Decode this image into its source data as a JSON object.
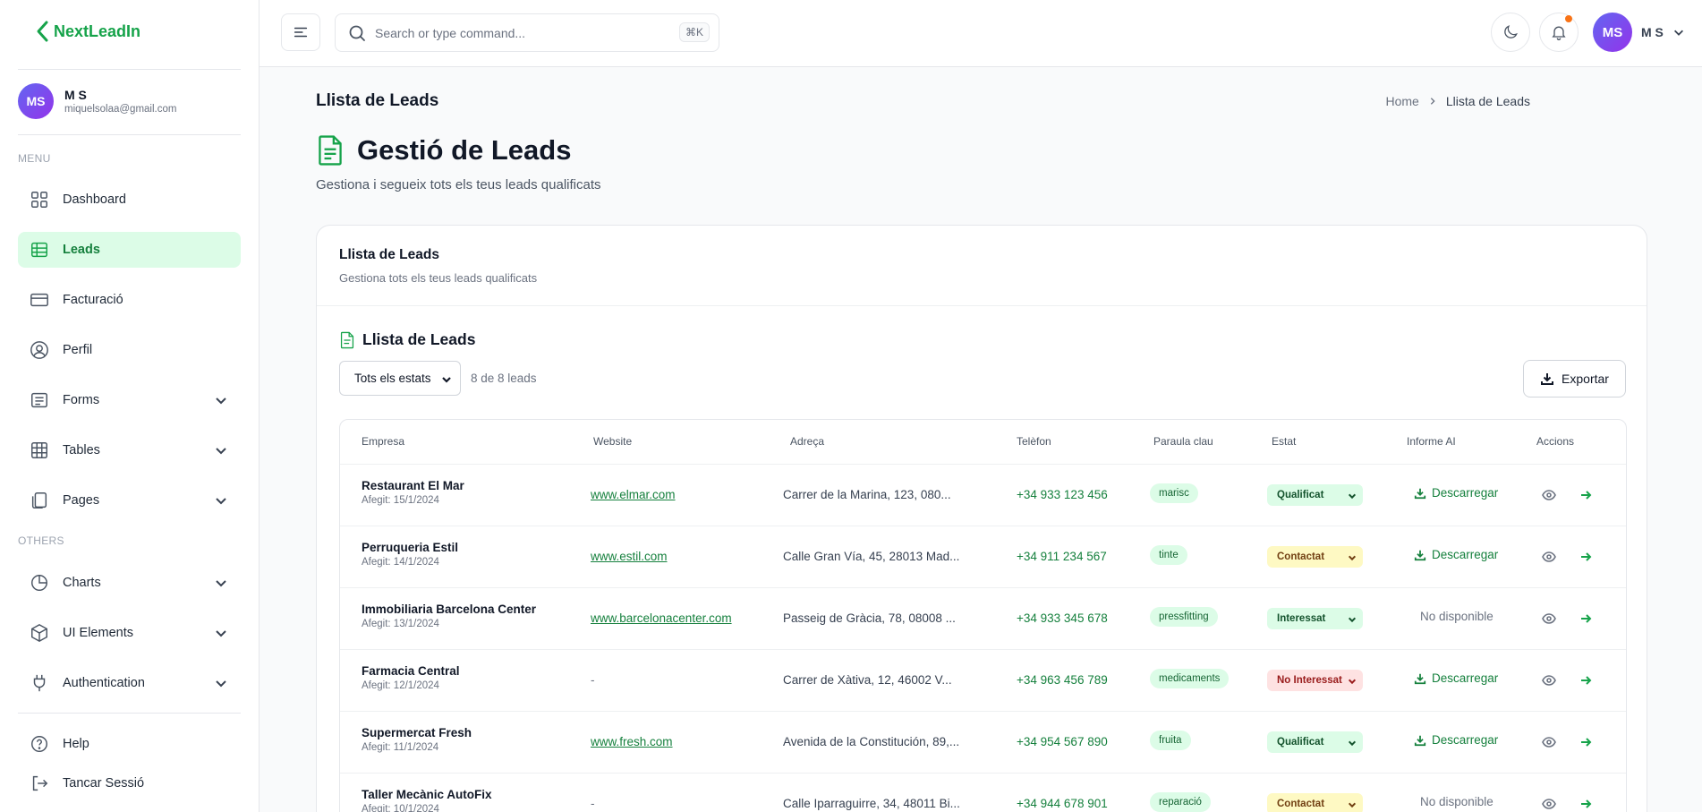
{
  "app": {
    "logo_text": "NextLeadIn"
  },
  "user": {
    "initials": "MS",
    "name": "M S",
    "email": "miquelsolaa@gmail.com"
  },
  "sidebar": {
    "menu_label": "MENU",
    "others_label": "OTHERS",
    "items": [
      {
        "label": "Dashboard",
        "icon": "grid-icon",
        "active": false
      },
      {
        "label": "Leads",
        "icon": "table-icon",
        "active": true
      },
      {
        "label": "Facturació",
        "icon": "credit-card-icon",
        "active": false
      },
      {
        "label": "Perfil",
        "icon": "user-circle-icon",
        "active": false
      },
      {
        "label": "Forms",
        "icon": "form-icon",
        "active": false,
        "expandable": true
      },
      {
        "label": "Tables",
        "icon": "table-grid-icon",
        "active": false,
        "expandable": true
      },
      {
        "label": "Pages",
        "icon": "pages-icon",
        "active": false,
        "expandable": true
      }
    ],
    "others": [
      {
        "label": "Charts",
        "icon": "pie-chart-icon",
        "expandable": true
      },
      {
        "label": "UI Elements",
        "icon": "cube-icon",
        "expandable": true
      },
      {
        "label": "Authentication",
        "icon": "plug-icon",
        "expandable": true
      }
    ],
    "footer": [
      {
        "label": "Help",
        "icon": "help-circle-icon"
      },
      {
        "label": "Tancar Sessió",
        "icon": "logout-icon"
      }
    ]
  },
  "header": {
    "search_placeholder": "Search or type command...",
    "search_shortcut": "⌘K",
    "user_label": "M S"
  },
  "page": {
    "heading": "Llista de Leads",
    "breadcrumb": [
      "Home",
      "Llista de Leads"
    ],
    "title": "Gestió de Leads",
    "subtitle": "Gestiona i segueix tots els teus leads qualificats"
  },
  "card": {
    "title": "Llista de Leads",
    "subtitle": "Gestiona tots els teus leads qualificats",
    "list_title": "Llista de Leads",
    "filter_value": "Tots els estats",
    "count_text": "8 de 8 leads",
    "export_label": "Exportar"
  },
  "table": {
    "columns": [
      "Empresa",
      "Website",
      "Adreça",
      "Telèfon",
      "Paraula clau",
      "Estat",
      "Informe AI",
      "Accions"
    ],
    "rows": [
      {
        "company": "Restaurant El Mar",
        "added": "Afegit: 15/1/2024",
        "website": "www.elmar.com",
        "address": "Carrer de la Marina, 123, 080...",
        "phone": "+34 933 123 456",
        "keyword": "marisc",
        "status": "Qualificat",
        "status_color": "green",
        "report": "Descarregar",
        "report_available": true
      },
      {
        "company": "Perruqueria Estil",
        "added": "Afegit: 14/1/2024",
        "website": "www.estil.com",
        "address": "Calle Gran Vía, 45, 28013 Mad...",
        "phone": "+34 911 234 567",
        "keyword": "tinte",
        "status": "Contactat",
        "status_color": "yellow",
        "report": "Descarregar",
        "report_available": true
      },
      {
        "company": "Immobiliaria Barcelona Center",
        "added": "Afegit: 13/1/2024",
        "website": "www.barcelonacenter.com",
        "address": "Passeig de Gràcia, 78, 08008 ...",
        "phone": "+34 933 345 678",
        "keyword": "pressfitting",
        "status": "Interessat",
        "status_color": "green",
        "report": "No disponible",
        "report_available": false
      },
      {
        "company": "Farmacia Central",
        "added": "Afegit: 12/1/2024",
        "website": "-",
        "address": "Carrer de Xàtiva, 12, 46002 V...",
        "phone": "+34 963 456 789",
        "keyword": "medicaments",
        "status": "No Interessat",
        "status_color": "red",
        "report": "Descarregar",
        "report_available": true
      },
      {
        "company": "Supermercat Fresh",
        "added": "Afegit: 11/1/2024",
        "website": "www.fresh.com",
        "address": "Avenida de la Constitución, 89,...",
        "phone": "+34 954 567 890",
        "keyword": "fruita",
        "status": "Qualificat",
        "status_color": "green",
        "report": "Descarregar",
        "report_available": true
      },
      {
        "company": "Taller Mecànic AutoFix",
        "added": "Afegit: 10/1/2024",
        "website": "-",
        "address": "Calle Iparraguirre, 34, 48011 Bi...",
        "phone": "+34 944 678 901",
        "keyword": "reparació",
        "status": "Contactat",
        "status_color": "yellow",
        "report": "No disponible",
        "report_available": false
      }
    ]
  },
  "colors": {
    "accent": "#16a34a",
    "accent_light": "#dcfce7",
    "notification": "#f97316"
  }
}
